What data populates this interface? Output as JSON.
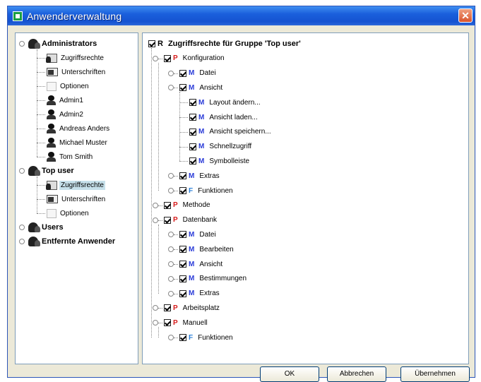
{
  "window": {
    "title": "Anwenderverwaltung"
  },
  "left_tree": [
    {
      "label": "Administrators",
      "icon": "group-icon",
      "bold": true,
      "depth": 0,
      "expanded": true
    },
    {
      "label": "Zugriffsrechte",
      "icon": "rights-icon",
      "depth": 1
    },
    {
      "label": "Unterschriften",
      "icon": "signature-icon",
      "depth": 1
    },
    {
      "label": "Optionen",
      "icon": "options-icon",
      "depth": 1
    },
    {
      "label": "Admin1",
      "icon": "user-icon",
      "depth": 1
    },
    {
      "label": "Admin2",
      "icon": "user-icon",
      "depth": 1
    },
    {
      "label": "Andreas Anders",
      "icon": "user-icon",
      "depth": 1
    },
    {
      "label": "Michael Muster",
      "icon": "user-icon",
      "depth": 1
    },
    {
      "label": "Tom Smith",
      "icon": "user-icon",
      "depth": 1
    },
    {
      "label": "Top user",
      "icon": "group-icon",
      "bold": true,
      "depth": 0,
      "expanded": true
    },
    {
      "label": "Zugriffsrechte",
      "icon": "rights-icon",
      "depth": 1,
      "selected": true
    },
    {
      "label": "Unterschriften",
      "icon": "signature-icon",
      "depth": 1
    },
    {
      "label": "Optionen",
      "icon": "options-icon",
      "depth": 1
    },
    {
      "label": "Users",
      "icon": "group-icon",
      "bold": true,
      "depth": 0
    },
    {
      "label": "Entfernte Anwender",
      "icon": "group-icon",
      "bold": true,
      "depth": 0
    }
  ],
  "right_tree": [
    {
      "letter": "R",
      "label": "Zugriffsrechte für Gruppe 'Top user'",
      "depth": 0,
      "bold": true
    },
    {
      "letter": "P",
      "label": "Konfiguration",
      "depth": 1
    },
    {
      "letter": "M",
      "label": "Datei",
      "depth": 2
    },
    {
      "letter": "M",
      "label": "Ansicht",
      "depth": 2
    },
    {
      "letter": "M",
      "label": "Layout ändern...",
      "depth": 3
    },
    {
      "letter": "M",
      "label": "Ansicht laden...",
      "depth": 3
    },
    {
      "letter": "M",
      "label": "Ansicht speichern...",
      "depth": 3
    },
    {
      "letter": "M",
      "label": "Schnellzugriff",
      "depth": 3
    },
    {
      "letter": "M",
      "label": "Symbolleiste",
      "depth": 3
    },
    {
      "letter": "M",
      "label": "Extras",
      "depth": 2
    },
    {
      "letter": "F",
      "label": "Funktionen",
      "depth": 2
    },
    {
      "letter": "P",
      "label": "Methode",
      "depth": 1
    },
    {
      "letter": "P",
      "label": "Datenbank",
      "depth": 1
    },
    {
      "letter": "M",
      "label": "Datei",
      "depth": 2
    },
    {
      "letter": "M",
      "label": "Bearbeiten",
      "depth": 2
    },
    {
      "letter": "M",
      "label": "Ansicht",
      "depth": 2
    },
    {
      "letter": "M",
      "label": "Bestimmungen",
      "depth": 2
    },
    {
      "letter": "M",
      "label": "Extras",
      "depth": 2
    },
    {
      "letter": "P",
      "label": "Arbeitsplatz",
      "depth": 1
    },
    {
      "letter": "P",
      "label": "Manuell",
      "depth": 1
    },
    {
      "letter": "F",
      "label": "Funktionen",
      "depth": 2
    }
  ],
  "buttons": {
    "ok": "OK",
    "cancel": "Abbrechen",
    "apply": "Übernehmen"
  }
}
